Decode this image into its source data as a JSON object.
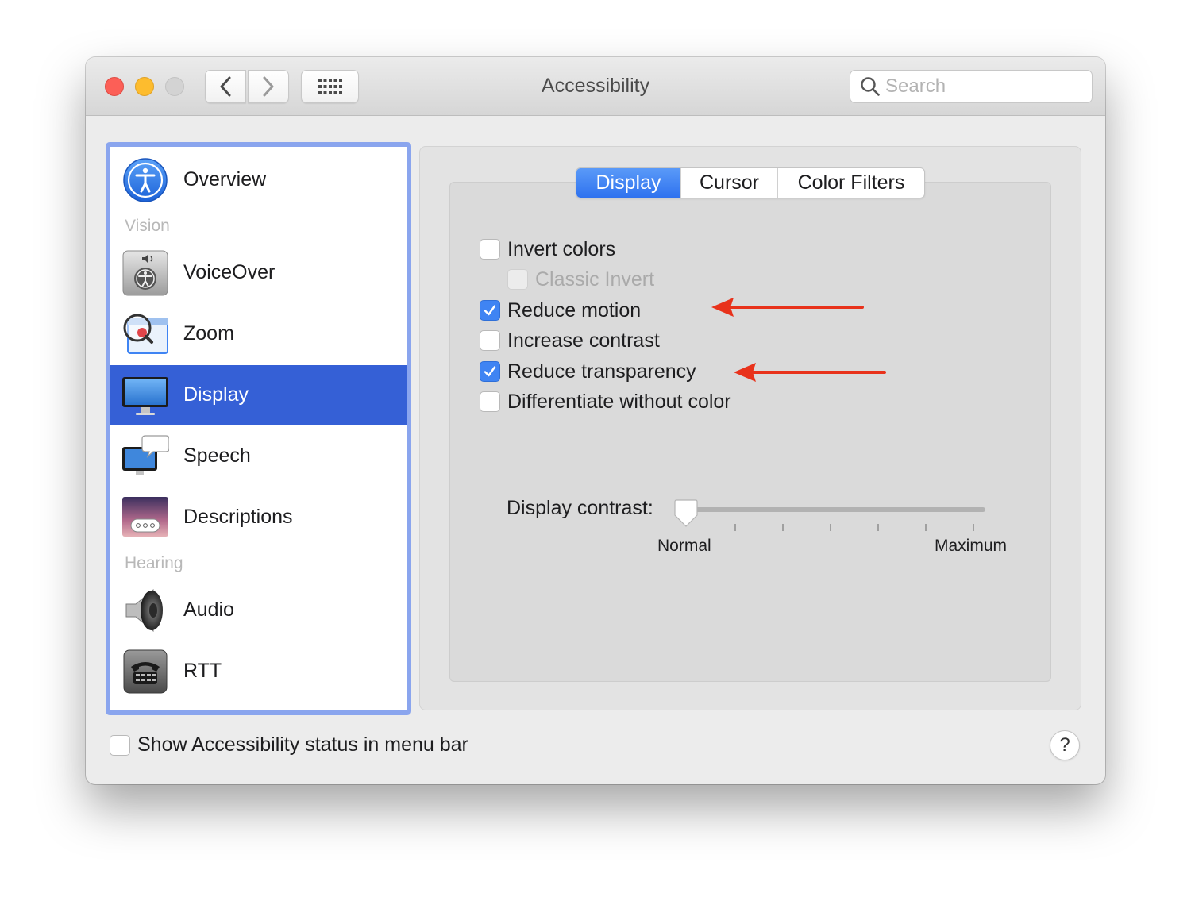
{
  "window": {
    "title": "Accessibility",
    "traffic_lights": [
      "close",
      "minimize",
      "zoom"
    ]
  },
  "toolbar": {
    "back_icon": "chevron-left-icon",
    "forward_icon": "chevron-right-icon",
    "grid_icon": "grid-icon"
  },
  "search": {
    "placeholder": "Search",
    "value": ""
  },
  "sidebar": {
    "top_item": {
      "label": "Overview",
      "icon": "accessibility-icon"
    },
    "sections": [
      {
        "title": "Vision",
        "items": [
          {
            "label": "VoiceOver",
            "icon": "voiceover-icon"
          },
          {
            "label": "Zoom",
            "icon": "zoom-icon"
          },
          {
            "label": "Display",
            "icon": "display-icon",
            "selected": true
          },
          {
            "label": "Speech",
            "icon": "speech-icon"
          },
          {
            "label": "Descriptions",
            "icon": "descriptions-icon"
          }
        ]
      },
      {
        "title": "Hearing",
        "items": [
          {
            "label": "Audio",
            "icon": "speaker-icon"
          },
          {
            "label": "RTT",
            "icon": "telephone-icon"
          }
        ]
      }
    ]
  },
  "tabs": [
    {
      "label": "Display",
      "active": true
    },
    {
      "label": "Cursor",
      "active": false
    },
    {
      "label": "Color Filters",
      "active": false
    }
  ],
  "options": [
    {
      "label": "Invert colors",
      "checked": false,
      "enabled": true
    },
    {
      "label": "Classic Invert",
      "checked": false,
      "enabled": false
    },
    {
      "label": "Reduce motion",
      "checked": true,
      "enabled": true
    },
    {
      "label": "Increase contrast",
      "checked": false,
      "enabled": true
    },
    {
      "label": "Reduce transparency",
      "checked": true,
      "enabled": true
    },
    {
      "label": "Differentiate without color",
      "checked": false,
      "enabled": true
    }
  ],
  "display_contrast": {
    "label": "Display contrast:",
    "min_label": "Normal",
    "max_label": "Maximum",
    "value": 0
  },
  "bottom": {
    "status_label": "Show Accessibility status in menu bar",
    "status_checked": false,
    "help_label": "?"
  },
  "annotations": {
    "arrow_color": "#e8321b"
  },
  "colors": {
    "selection": "#3560d6",
    "accent": "#3f84f3",
    "sidebar_focus_ring": "#8aa5ee"
  }
}
